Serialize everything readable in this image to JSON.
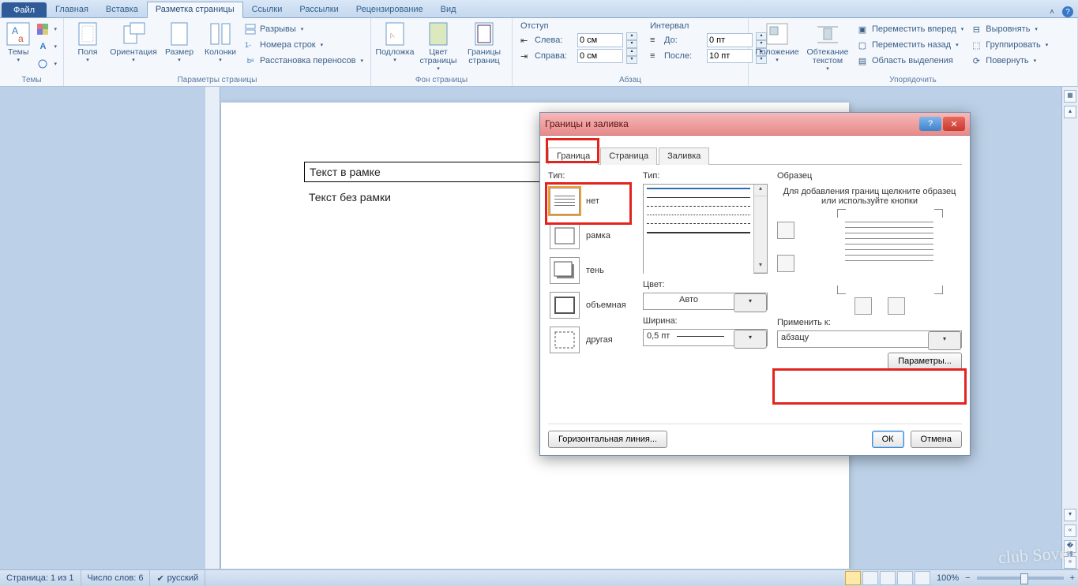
{
  "tabs": {
    "file": "Файл",
    "home": "Главная",
    "insert": "Вставка",
    "layout": "Разметка страницы",
    "refs": "Ссылки",
    "mail": "Рассылки",
    "review": "Рецензирование",
    "view": "Вид"
  },
  "ribbon": {
    "themes": {
      "themes": "Темы",
      "group": "Темы"
    },
    "page_setup": {
      "margins": "Поля",
      "orientation": "Ориентация",
      "size": "Размер",
      "columns": "Колонки",
      "breaks": "Разрывы",
      "line_numbers": "Номера строк",
      "hyphenation": "Расстановка переносов",
      "group": "Параметры страницы"
    },
    "page_bg": {
      "watermark": "Подложка",
      "page_color": "Цвет страницы",
      "borders": "Границы страниц",
      "group": "Фон страницы"
    },
    "paragraph": {
      "indent_title": "Отступ",
      "spacing_title": "Интервал",
      "left": "Слева:",
      "right": "Справа:",
      "before": "До:",
      "after": "После:",
      "left_val": "0 см",
      "right_val": "0 см",
      "before_val": "0 пт",
      "after_val": "10 пт",
      "group": "Абзац"
    },
    "arrange": {
      "position": "Положение",
      "wrap": "Обтекание текстом",
      "bring_fwd": "Переместить вперед",
      "send_back": "Переместить назад",
      "selection": "Область выделения",
      "align": "Выровнять",
      "group_btn": "Группировать",
      "rotate": "Повернуть",
      "group": "Упорядочить"
    }
  },
  "document": {
    "framed": "Текст в рамке",
    "unframed": "Текст без рамки"
  },
  "dialog": {
    "title": "Границы и заливка",
    "tabs": {
      "border": "Граница",
      "page": "Страница",
      "fill": "Заливка"
    },
    "type_label": "Тип:",
    "types": {
      "none": "нет",
      "box": "рамка",
      "shadow": "тень",
      "threeD": "объемная",
      "custom": "другая"
    },
    "style_label": "Тип:",
    "color_label": "Цвет:",
    "color_val": "Авто",
    "width_label": "Ширина:",
    "width_val": "0,5 пт",
    "preview_label": "Образец",
    "preview_hint": "Для добавления границ щелкните образец или используйте кнопки",
    "apply_label": "Применить к:",
    "apply_val": "абзацу",
    "options": "Параметры...",
    "hr": "Горизонтальная линия...",
    "ok": "ОК",
    "cancel": "Отмена"
  },
  "status": {
    "page": "Страница: 1 из 1",
    "words": "Число слов: 6",
    "lang": "русский",
    "zoom": "100%"
  },
  "watermark": "club Sovet"
}
